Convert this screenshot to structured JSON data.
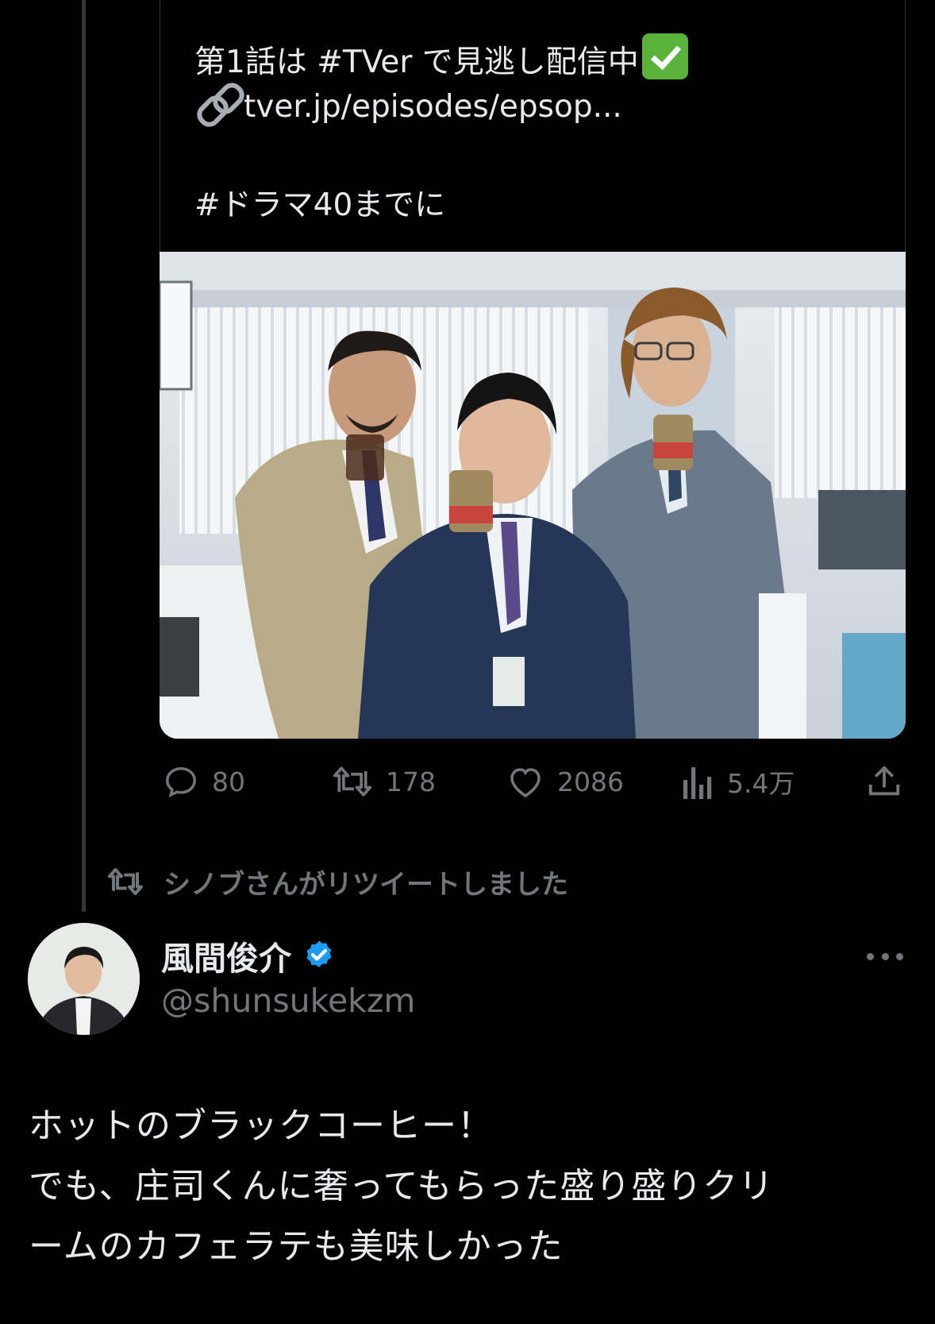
{
  "quoted_tweet": {
    "line1": "第1話は #TVer で見逃し配信中",
    "line2": "tver.jp/episodes/epsop...",
    "line3": "#ドラマ40までに",
    "check_emoji": "check-mark-button-emoji",
    "link_emoji": "link-emoji"
  },
  "actions": {
    "replies": "80",
    "retweets": "178",
    "likes": "2086",
    "views": "5.4万"
  },
  "retweet_notice": "シノブさんがリツイートしました",
  "author": {
    "name": "風間俊介",
    "handle": "@shunsukekzm",
    "verified_color": "#1d9bf0"
  },
  "tweet": {
    "lines": [
      "ホットのブラックコーヒー！",
      "でも、庄司くんに奢ってもらった盛り盛りクリ",
      "ームのカフェラテも美味しかった"
    ]
  },
  "colors": {
    "background": "#000000",
    "text": "#e7e9ea",
    "muted": "#71767b",
    "accent": "#1d9bf0"
  }
}
